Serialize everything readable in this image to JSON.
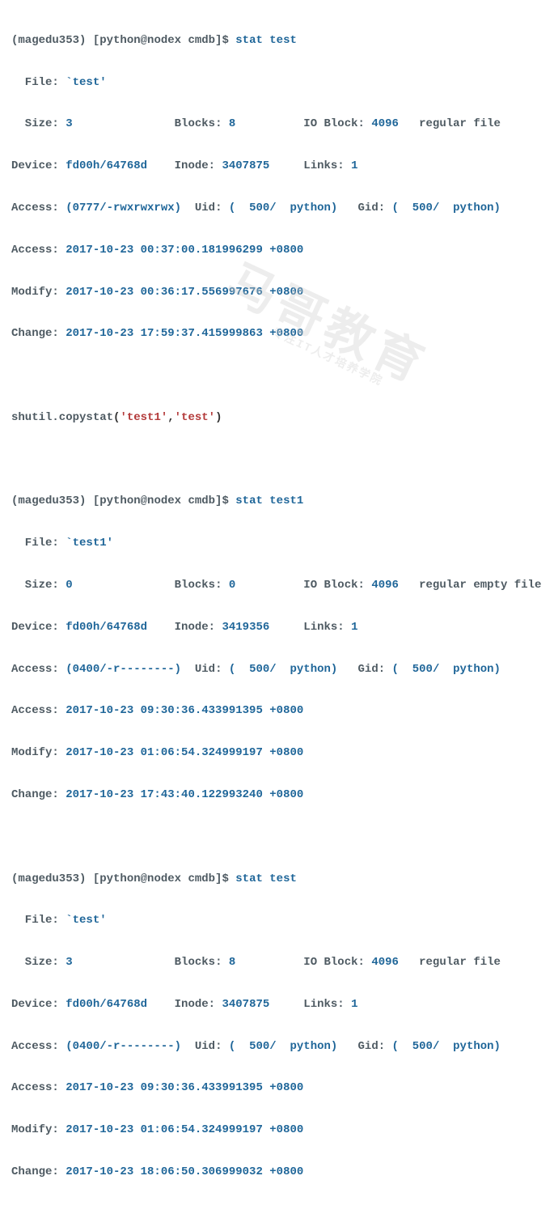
{
  "prompt": {
    "env": "(magedu353)",
    "user_host": "[python@nodex cmdb]$"
  },
  "commands": {
    "stat_test": "stat test",
    "stat_test1": "stat test1"
  },
  "copystat": {
    "func": "shutil.copystat",
    "arg1": "'test1'",
    "arg2": "'test'"
  },
  "block1": {
    "file_label": "  File: ",
    "file_val": "`test'",
    "size_label": "  Size: ",
    "size_val": "3",
    "blocks_label": "Blocks: ",
    "blocks_val": "8",
    "ioblock_label": "IO Block: ",
    "ioblock_val": "4096",
    "filetype": "   regular file",
    "device_label": "Device: ",
    "device_val": "fd00h/64768d",
    "inode_label": "Inode: ",
    "inode_val": "3407875",
    "links_label": "Links: ",
    "links_val": "1",
    "access_perm_label": "Access: ",
    "access_perm_val": "(0777/-rwxrwxrwx)",
    "uid_label": "Uid: ",
    "uid_val": "(  500/  python)",
    "gid_label": "Gid: ",
    "gid_val": "(  500/  python)",
    "access_time_label": "Access: ",
    "access_time_val": "2017-10-23 00:37:00.181996299 +0800",
    "modify_label": "Modify: ",
    "modify_val": "2017-10-23 00:36:17.556997676 +0800",
    "change_label": "Change: ",
    "change_val": "2017-10-23 17:59:37.415999863 +0800"
  },
  "block2": {
    "file_label": "  File: ",
    "file_val": "`test1'",
    "size_label": "  Size: ",
    "size_val": "0",
    "blocks_label": "Blocks: ",
    "blocks_val": "0",
    "ioblock_label": "IO Block: ",
    "ioblock_val": "4096",
    "filetype": "   regular empty file",
    "device_label": "Device: ",
    "device_val": "fd00h/64768d",
    "inode_label": "Inode: ",
    "inode_val": "3419356",
    "links_label": "Links: ",
    "links_val": "1",
    "access_perm_label": "Access: ",
    "access_perm_val": "(0400/-r--------)",
    "uid_label": "Uid: ",
    "uid_val": "(  500/  python)",
    "gid_label": "Gid: ",
    "gid_val": "(  500/  python)",
    "access_time_label": "Access: ",
    "access_time_val": "2017-10-23 09:30:36.433991395 +0800",
    "modify_label": "Modify: ",
    "modify_val": "2017-10-23 01:06:54.324999197 +0800",
    "change_label": "Change: ",
    "change_val": "2017-10-23 17:43:40.122993240 +0800"
  },
  "block3": {
    "file_label": "  File: ",
    "file_val": "`test'",
    "size_label": "  Size: ",
    "size_val": "3",
    "blocks_label": "Blocks: ",
    "blocks_val": "8",
    "ioblock_label": "IO Block: ",
    "ioblock_val": "4096",
    "filetype": "   regular file",
    "device_label": "Device: ",
    "device_val": "fd00h/64768d",
    "inode_label": "Inode: ",
    "inode_val": "3407875",
    "links_label": "Links: ",
    "links_val": "1",
    "access_perm_label": "Access: ",
    "access_perm_val": "(0400/-r--------)",
    "uid_label": "Uid: ",
    "uid_val": "(  500/  python)",
    "gid_label": "Gid: ",
    "gid_val": "(  500/  python)",
    "access_time_label": "Access: ",
    "access_time_val": "2017-10-23 09:30:36.433991395 +0800",
    "modify_label": "Modify: ",
    "modify_val": "2017-10-23 01:06:54.324999197 +0800",
    "change_label": "Change: ",
    "change_val": "2017-10-23 18:06:50.306999032 +0800"
  },
  "watermark": {
    "main": "马哥教育",
    "sub": "专注IT人才培养学院"
  }
}
